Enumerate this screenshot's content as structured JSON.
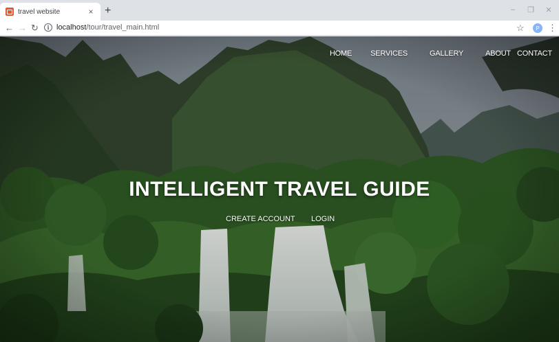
{
  "browser": {
    "tab_title": "travel website",
    "tab_close": "×",
    "new_tab": "+",
    "url_host": "localhost",
    "url_path": "/tour/travel_main.html",
    "profile_initial": "P",
    "icons": [
      "favicon-icon",
      "close-icon",
      "plus-icon",
      "back-arrow-icon",
      "forward-arrow-icon",
      "reload-icon",
      "info-icon",
      "star-icon",
      "profile-icon",
      "menu-dots-icon"
    ]
  },
  "site": {
    "nav": [
      "HOME",
      "SERVICES",
      "GALLERY",
      "ABOUT",
      "CONTACT"
    ],
    "hero_title": "INTELLIGENT TRAVEL GUIDE",
    "create_account": "CREATE ACCOUNT",
    "login": "LOGIN"
  },
  "colors": {
    "chrome_bg": "#dee1e6",
    "tab_bg": "#ffffff",
    "favicon": "#e8572d",
    "text_white": "#ffffff",
    "foliage": "#2f5a25",
    "sky": "#9aa3a8"
  }
}
